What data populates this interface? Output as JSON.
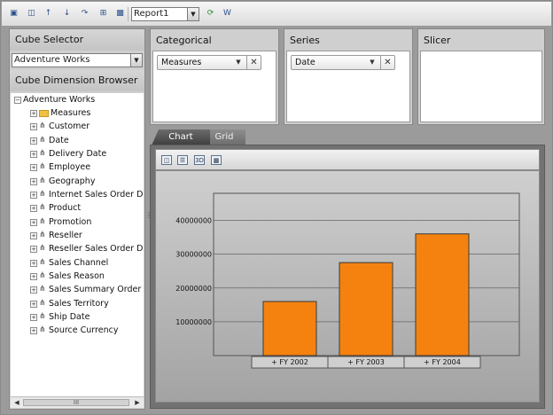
{
  "toolbar": {
    "report_select_value": "Report1",
    "icons": [
      "new-report-icon",
      "bar-view-icon",
      "sort-asc-icon",
      "sort-desc-icon",
      "export-icon",
      "save-icon",
      "refresh-icon",
      "word-export-icon"
    ]
  },
  "left_panel": {
    "cube_selector_title": "Cube Selector",
    "cube_selected": "Adventure Works",
    "browser_title": "Cube Dimension Browser",
    "tree": {
      "root": "Adventure Works",
      "items": [
        "Measures",
        "Customer",
        "Date",
        "Delivery Date",
        "Employee",
        "Geography",
        "Internet Sales Order De",
        "Product",
        "Promotion",
        "Reseller",
        "Reseller Sales Order De",
        "Sales Channel",
        "Sales Reason",
        "Sales Summary Order D",
        "Sales Territory",
        "Ship Date",
        "Source Currency"
      ]
    },
    "scroll_thumb_label": "III"
  },
  "zones": {
    "categorical": {
      "title": "Categorical",
      "chip": "Measures"
    },
    "series": {
      "title": "Series",
      "chip": "Date"
    },
    "slicer": {
      "title": "Slicer"
    }
  },
  "tabs": {
    "chart": "Chart",
    "grid": "Grid"
  },
  "chart_toolbar": {
    "icons": [
      "chart-type-icon",
      "chart-settings-icon",
      "3d-toggle-icon",
      "chart-legend-icon"
    ],
    "btn_3d_label": "3D"
  },
  "chart_data": {
    "type": "bar",
    "categories": [
      "+ FY 2002",
      "+ FY 2003",
      "+ FY 2004"
    ],
    "values": [
      16000000,
      27500000,
      36000000
    ],
    "yticks": [
      10000000,
      20000000,
      30000000,
      40000000
    ],
    "ytick_labels": [
      "10000000",
      "20000000",
      "30000000",
      "40000000"
    ],
    "ylim": [
      0,
      48000000
    ],
    "grid": true,
    "bar_color": "#f5820f"
  }
}
